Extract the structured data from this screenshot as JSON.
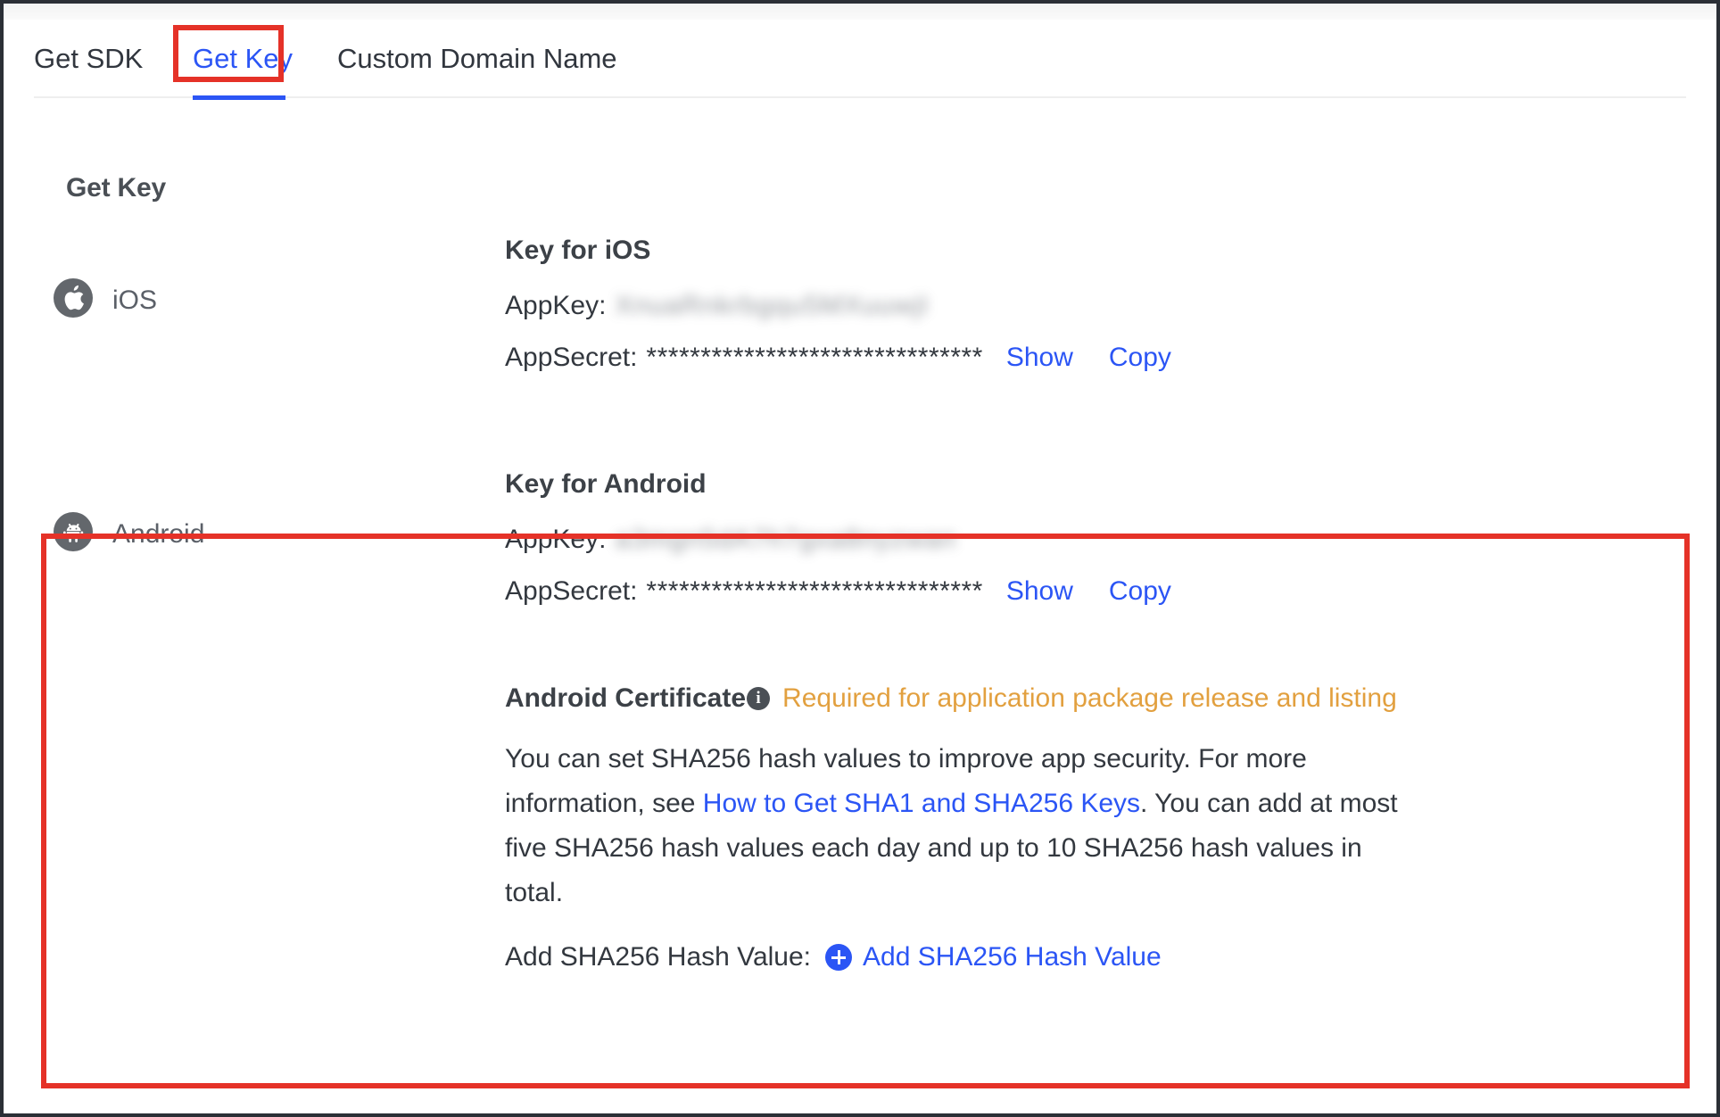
{
  "tabs": [
    {
      "label": "Get SDK",
      "active": false
    },
    {
      "label": "Get Key",
      "active": true
    },
    {
      "label": "Custom Domain Name",
      "active": false
    }
  ],
  "page": {
    "title": "Get Key"
  },
  "platforms": [
    {
      "name": "iOS",
      "icon": "apple-icon",
      "key_heading": "Key for iOS",
      "appkey_label": "AppKey:",
      "appkey_value": "XnuaRnkrbgqu5MXuuwjI",
      "appsecret_label": "AppSecret:",
      "appsecret_value": "*******************************",
      "show_label": "Show",
      "copy_label": "Copy"
    },
    {
      "name": "Android",
      "icon": "android-icon",
      "key_heading": "Key for Android",
      "appkey_label": "AppKey:",
      "appkey_value": "a3mgn5dA7h7gxa8nyzwan",
      "appsecret_label": "AppSecret:",
      "appsecret_value": "*******************************",
      "show_label": "Show",
      "copy_label": "Copy"
    }
  ],
  "certificate": {
    "title": "Android Certificate",
    "info_icon_glyph": "i",
    "note": "Required for application package release and listing",
    "description_part1": "You can set SHA256 hash values to improve app security. For more information, see ",
    "description_link": "How to Get SHA1 and SHA256 Keys",
    "description_part2": ". You can add at most five SHA256 hash values each day and up to 10 SHA256 hash values in total.",
    "add_label": "Add SHA256 Hash Value:",
    "add_link": "Add SHA256 Hash Value"
  },
  "colors": {
    "link_blue": "#2b55f5",
    "warning_orange": "#e2a03f",
    "highlight_red": "#e53228",
    "icon_gray": "#63676c"
  }
}
